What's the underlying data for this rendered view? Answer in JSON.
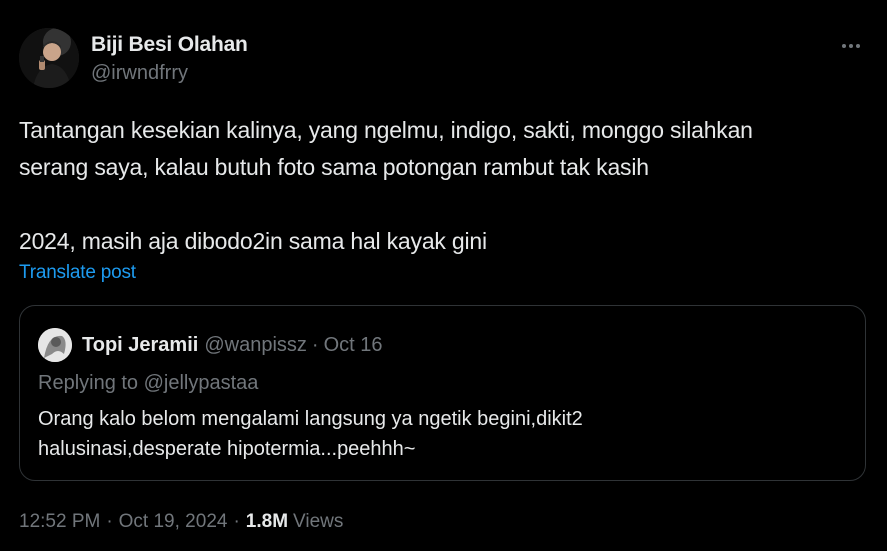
{
  "author": {
    "display_name": "Biji Besi Olahan",
    "handle": "@irwndfrry"
  },
  "post": {
    "text": "Tantangan kesekian kalinya, yang ngelmu, indigo, sakti, monggo silahkan\nserang saya, kalau butuh foto sama potongan rambut tak kasih\n\n2024, masih aja dibodo2in sama hal kayak gini",
    "translate_label": "Translate post"
  },
  "quote": {
    "display_name": "Topi Jeramii",
    "handle": "@wanpissz",
    "separator": "·",
    "date": "Oct 16",
    "replying_to": "Replying to @jellypastaa",
    "text": "Orang kalo belom mengalami langsung ya ngetik begini,dikit2\nhalusinasi,desperate hipotermia...peehhh~"
  },
  "meta": {
    "time": "12:52 PM",
    "dot1": "·",
    "date": "Oct 19, 2024",
    "dot2": "·",
    "views_count": "1.8M",
    "views_label": "Views"
  },
  "icons": {
    "more": "more-horizontal-icon"
  },
  "colors": {
    "background": "#000000",
    "primary_text": "#e7e9ea",
    "secondary_text": "#71767b",
    "link": "#1d9bf0",
    "border": "#2f3336"
  }
}
